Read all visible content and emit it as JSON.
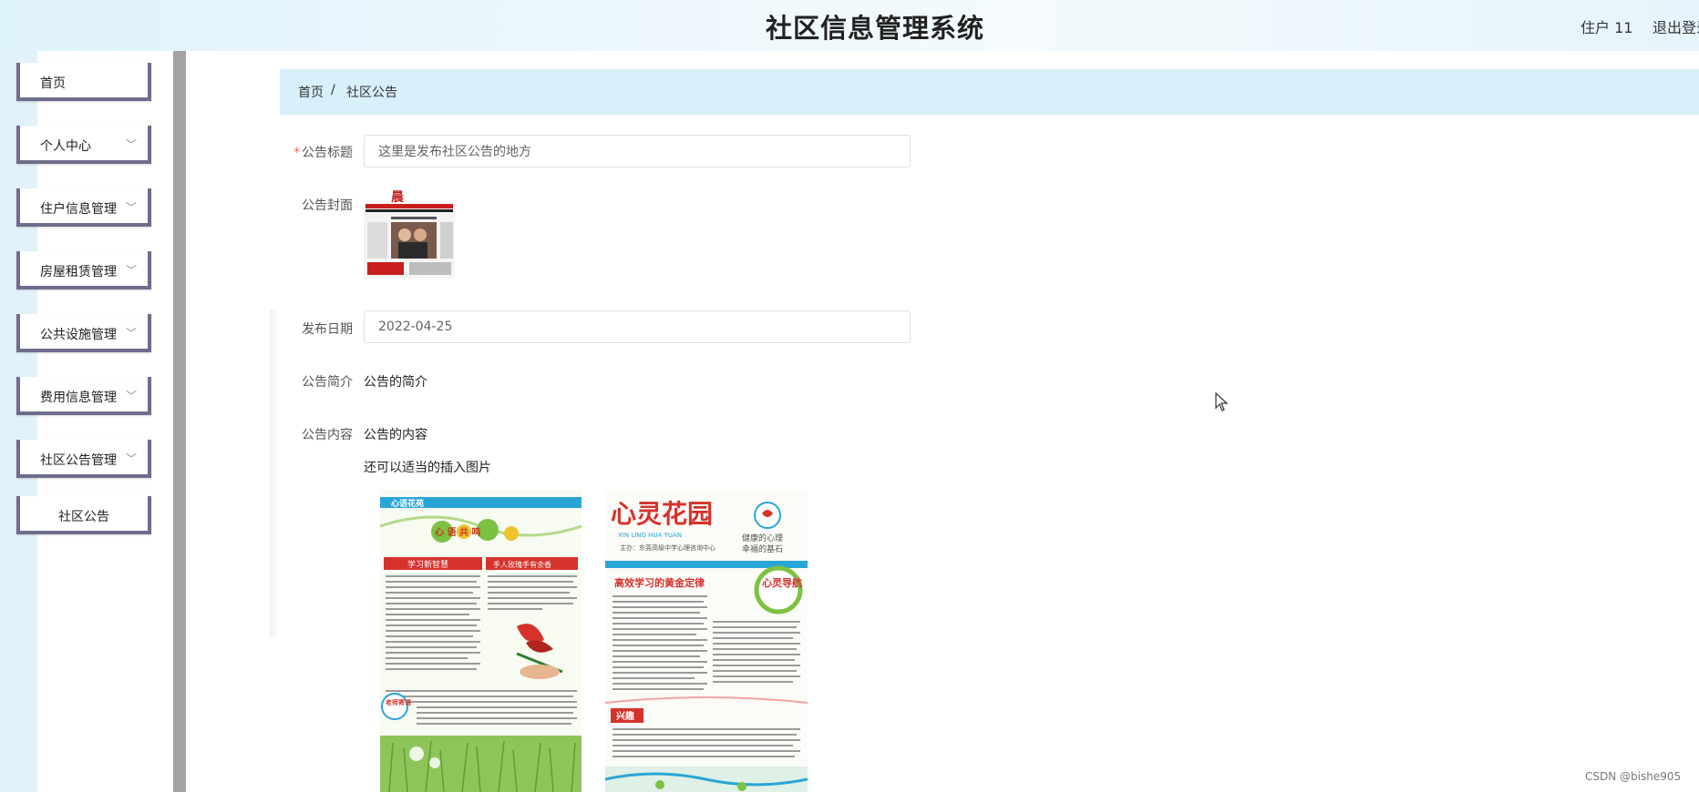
{
  "header": {
    "title": "社区信息管理系统",
    "user": "住户 11",
    "logout": "退出登录"
  },
  "sidebar": {
    "items": [
      {
        "label": "首页",
        "has_chevron": false
      },
      {
        "label": "个人中心",
        "has_chevron": true
      },
      {
        "label": "住户信息管理",
        "has_chevron": true
      },
      {
        "label": "房屋租赁管理",
        "has_chevron": true
      },
      {
        "label": "公共设施管理",
        "has_chevron": true
      },
      {
        "label": "费用信息管理",
        "has_chevron": true
      },
      {
        "label": "社区公告管理",
        "has_chevron": true
      },
      {
        "label": "社区公告",
        "has_chevron": false
      }
    ]
  },
  "breadcrumb": {
    "home": "首页",
    "separator": "/",
    "current": "社区公告"
  },
  "form": {
    "title_label": "公告标题",
    "title_value": "这里是发布社区公告的地方",
    "cover_label": "公告封面",
    "date_label": "发布日期",
    "date_value": "2022-04-25",
    "summary_label": "公告简介",
    "summary_value": "公告的简介",
    "content_label": "公告内容",
    "content_line1": "公告的内容",
    "content_line2": "还可以适当的插入图片"
  },
  "posters": {
    "left": {
      "header": "心语花苑",
      "badge": "心 语 共 鸣",
      "section_left": "学习新智慧",
      "section_right": "手人玫瑰手有余香",
      "tag": "老师寄语"
    },
    "right": {
      "title": "心灵花园",
      "pinyin": "XIN LING HUA YUAN",
      "slogan1": "健康的心理",
      "slogan2": "幸福的基石",
      "host": "主办：东莞高级中学心理咨询中心",
      "subtitle": "高效学习的黄金定律",
      "nav": "心灵导航",
      "section": "兴趣"
    }
  },
  "watermark": "CSDN @bishe905",
  "colors": {
    "accent": "#d8f0fa",
    "menu_border": "#6f6d8c",
    "required": "#f56c6c"
  }
}
